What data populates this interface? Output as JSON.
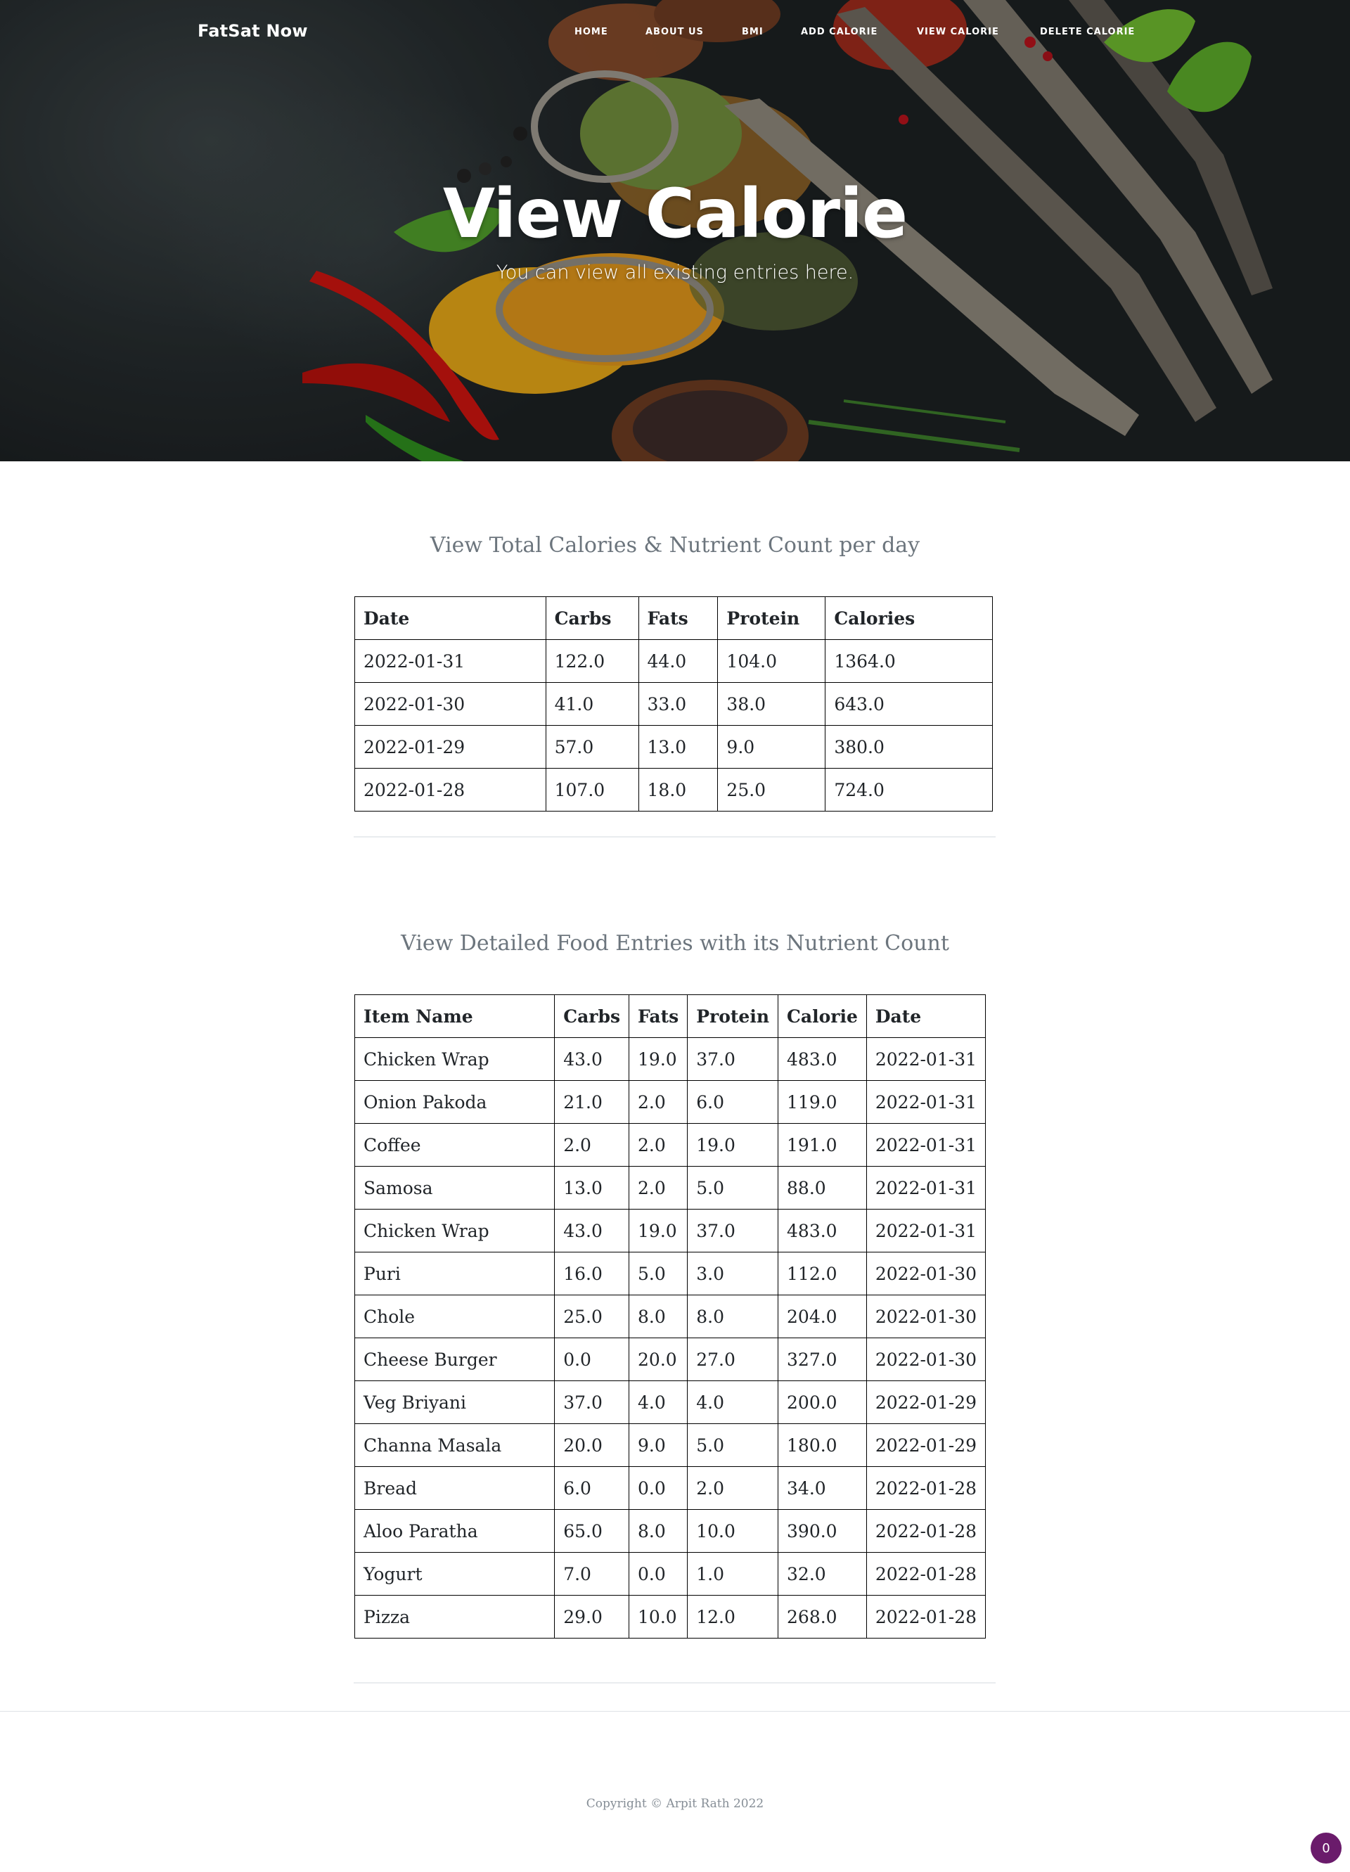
{
  "navbar": {
    "brand": "FatSat Now",
    "links": [
      "HOME",
      "ABOUT US",
      "BMI",
      "ADD CALORIE",
      "VIEW CALORIE",
      "DELETE CALORIE"
    ]
  },
  "hero": {
    "title": "View Calorie",
    "subtitle": "You can view all existing entries here."
  },
  "daily": {
    "title": "View Total Calories & Nutrient Count per day",
    "headers": [
      "Date",
      "Carbs",
      "Fats",
      "Protein",
      "Calories"
    ],
    "rows": [
      [
        "2022-01-31",
        "122.0",
        "44.0",
        "104.0",
        "1364.0"
      ],
      [
        "2022-01-30",
        "41.0",
        "33.0",
        "38.0",
        "643.0"
      ],
      [
        "2022-01-29",
        "57.0",
        "13.0",
        "9.0",
        "380.0"
      ],
      [
        "2022-01-28",
        "107.0",
        "18.0",
        "25.0",
        "724.0"
      ]
    ]
  },
  "detailed": {
    "title": "View Detailed Food Entries with its Nutrient Count",
    "headers": [
      "Item Name",
      "Carbs",
      "Fats",
      "Protein",
      "Calorie",
      "Date"
    ],
    "rows": [
      [
        "Chicken Wrap",
        "43.0",
        "19.0",
        "37.0",
        "483.0",
        "2022-01-31"
      ],
      [
        "Onion Pakoda",
        "21.0",
        "2.0",
        "6.0",
        "119.0",
        "2022-01-31"
      ],
      [
        "Coffee",
        "2.0",
        "2.0",
        "19.0",
        "191.0",
        "2022-01-31"
      ],
      [
        "Samosa",
        "13.0",
        "2.0",
        "5.0",
        "88.0",
        "2022-01-31"
      ],
      [
        "Chicken Wrap",
        "43.0",
        "19.0",
        "37.0",
        "483.0",
        "2022-01-31"
      ],
      [
        "Puri",
        "16.0",
        "5.0",
        "3.0",
        "112.0",
        "2022-01-30"
      ],
      [
        "Chole",
        "25.0",
        "8.0",
        "8.0",
        "204.0",
        "2022-01-30"
      ],
      [
        "Cheese Burger",
        "0.0",
        "20.0",
        "27.0",
        "327.0",
        "2022-01-30"
      ],
      [
        "Veg Briyani",
        "37.0",
        "4.0",
        "4.0",
        "200.0",
        "2022-01-29"
      ],
      [
        "Channa Masala",
        "20.0",
        "9.0",
        "5.0",
        "180.0",
        "2022-01-29"
      ],
      [
        "Bread",
        "6.0",
        "0.0",
        "2.0",
        "34.0",
        "2022-01-28"
      ],
      [
        "Aloo Paratha",
        "65.0",
        "8.0",
        "10.0",
        "390.0",
        "2022-01-28"
      ],
      [
        "Yogurt",
        "7.0",
        "0.0",
        "1.0",
        "32.0",
        "2022-01-28"
      ],
      [
        "Pizza",
        "29.0",
        "10.0",
        "12.0",
        "268.0",
        "2022-01-28"
      ]
    ]
  },
  "footer": {
    "copyright": "Copyright © Arpit Rath 2022",
    "badge": "0"
  }
}
